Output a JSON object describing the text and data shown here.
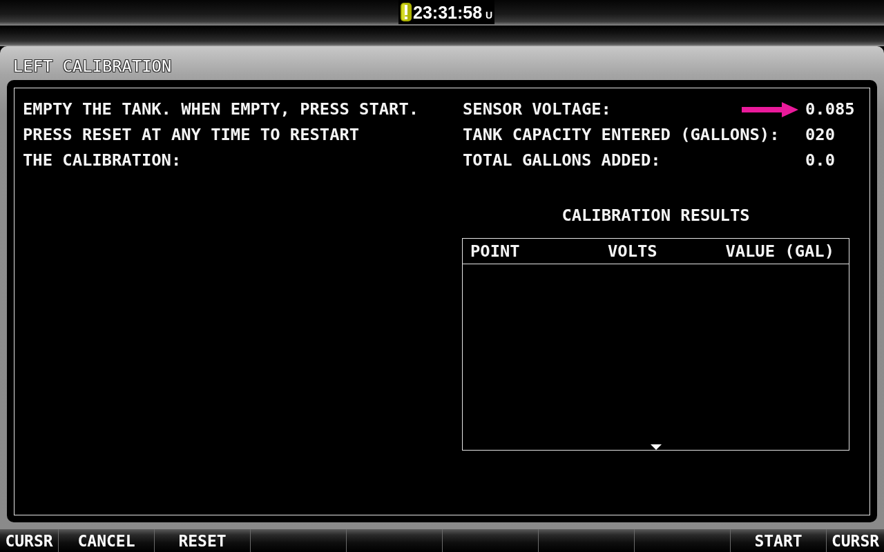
{
  "status_bar": {
    "clock": "23:31:58",
    "time_zone": "U"
  },
  "page": {
    "title": "LEFT CALIBRATION"
  },
  "instructions": [
    "EMPTY THE TANK. WHEN EMPTY, PRESS START.",
    "PRESS RESET AT ANY TIME TO RESTART",
    "THE CALIBRATION:"
  ],
  "readings": [
    {
      "label": "SENSOR VOLTAGE:",
      "value": "0.085",
      "arrow": true
    },
    {
      "label": "TANK CAPACITY ENTERED (GALLONS):",
      "value": "020",
      "arrow": false
    },
    {
      "label": "TOTAL GALLONS ADDED:",
      "value": "0.0",
      "arrow": false
    }
  ],
  "results": {
    "title": "CALIBRATION RESULTS",
    "columns": [
      "POINT",
      "VOLTS",
      "VALUE (GAL)"
    ]
  },
  "softkeys": [
    {
      "kind": "labeled",
      "label": "CURSR"
    },
    {
      "kind": "labeled",
      "label": "CANCEL"
    },
    {
      "kind": "labeled",
      "label": "RESET"
    },
    {
      "kind": "blank"
    },
    {
      "kind": "blank"
    },
    {
      "kind": "blank"
    },
    {
      "kind": "blank"
    },
    {
      "kind": "blank"
    },
    {
      "kind": "labeled",
      "label": "START"
    },
    {
      "kind": "labeled",
      "label": "CURSR"
    }
  ]
}
